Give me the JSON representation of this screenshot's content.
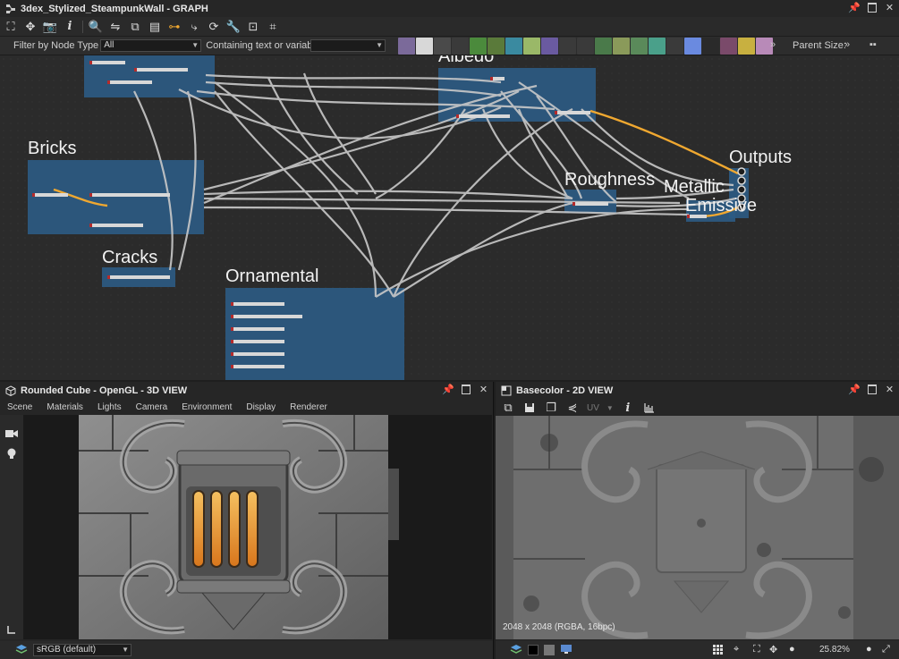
{
  "graph": {
    "title": "3dex_Stylized_SteampunkWall - GRAPH",
    "filter_label": "Filter by Node Type",
    "filter_value": "All",
    "containing_label": "Containing text or variable",
    "parent_size_label": "Parent Size:",
    "frames": {
      "albedo": "Albedo",
      "bricks": "Bricks",
      "cracks": "Cracks",
      "ornamental": "Ornamental",
      "roughness": "Roughness",
      "metallic": "Metallic",
      "emissive": "Emissive",
      "outputs": "Outputs"
    },
    "colors": {
      "frame": "#2d5a82",
      "wire": "#c9c9c9",
      "wire_accent": "#f0a830",
      "node_marker": "#b52b2b"
    }
  },
  "view3d": {
    "title": "Rounded Cube - OpenGL - 3D VIEW",
    "menu": [
      "Scene",
      "Materials",
      "Lights",
      "Camera",
      "Environment",
      "Display",
      "Renderer"
    ],
    "colorspace": "sRGB (default)"
  },
  "view2d": {
    "title": "Basecolor - 2D VIEW",
    "uv_label": "UV",
    "image_info": "2048 x 2048 (RGBA, 16bpc)",
    "zoom": "25.82%"
  }
}
